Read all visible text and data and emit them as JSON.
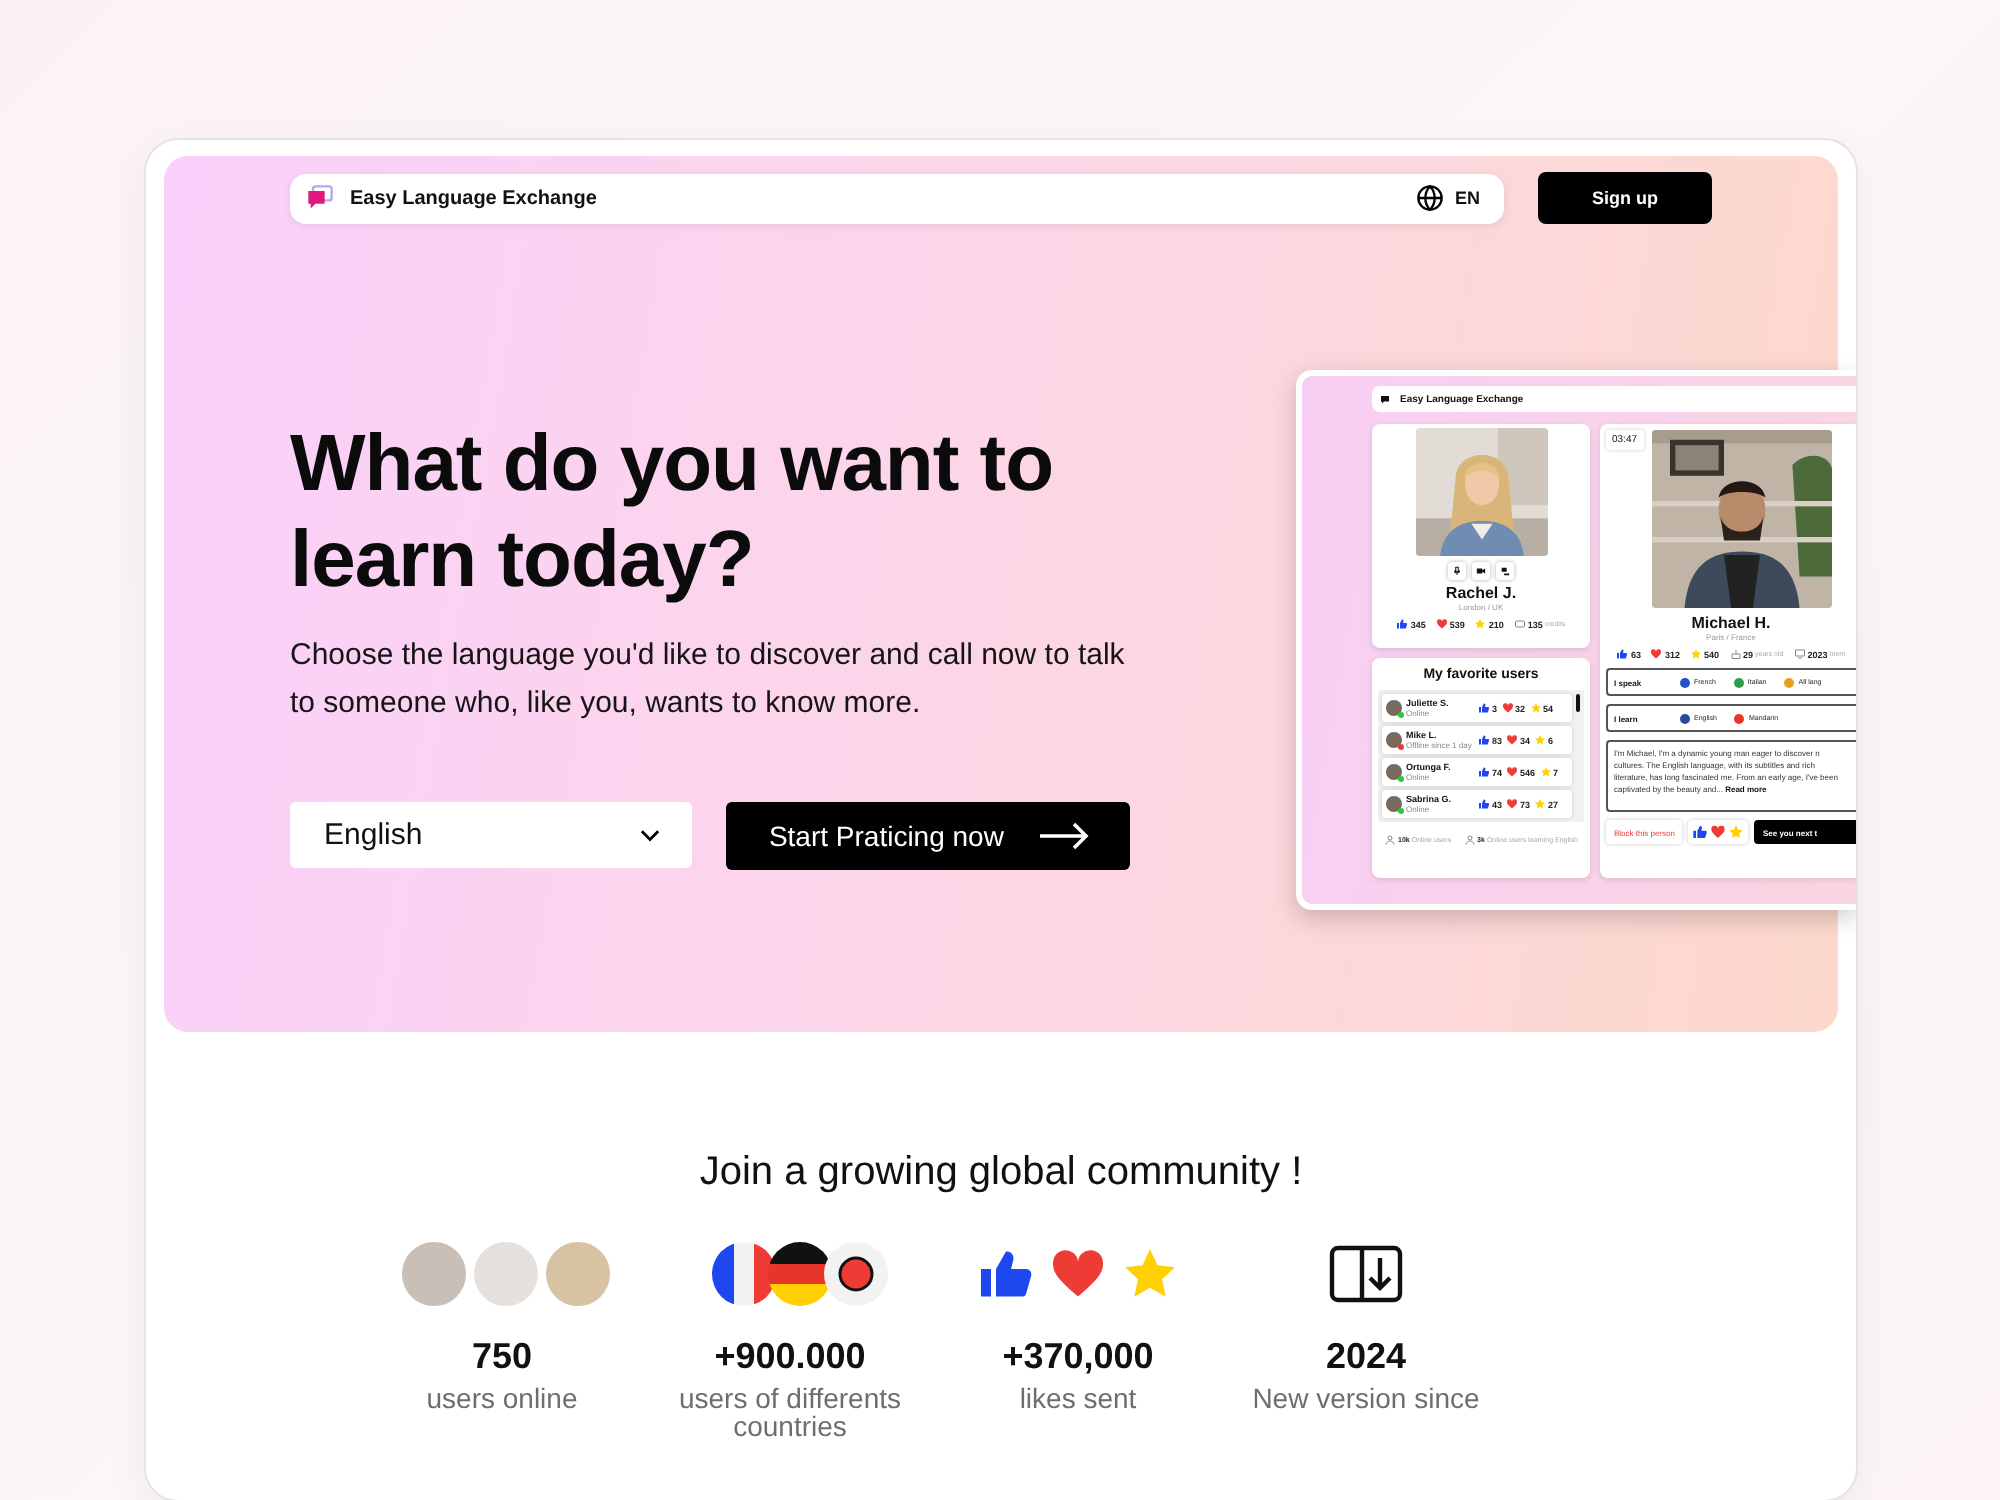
{
  "nav": {
    "logo": "Easy Language Exchange",
    "language": "EN",
    "signup": "Sign up"
  },
  "hero": {
    "title": "What do you want to learn today?",
    "subtitle": "Choose the language you'd like to discover and call now to talk to someone who, like you, wants to know more.",
    "select": "English",
    "cta": "Start Praticing now"
  },
  "preview": {
    "app_title": "Easy Language Exchange",
    "profile": {
      "name": "Rachel J.",
      "location": "London / UK",
      "likes": "345",
      "hearts": "539",
      "stars": "210",
      "credits": "135",
      "credits_label": "credits"
    },
    "favorites": {
      "title": "My favorite users",
      "users": [
        {
          "name": "Juliette S.",
          "status": "Online",
          "online": true,
          "likes": "3",
          "hearts": "32",
          "stars": "54"
        },
        {
          "name": "Mike L.",
          "status": "Offline since 1 day",
          "online": false,
          "likes": "83",
          "hearts": "34",
          "stars": "6"
        },
        {
          "name": "Ortunga F.",
          "status": "Online",
          "online": true,
          "likes": "74",
          "hearts": "546",
          "stars": "7"
        },
        {
          "name": "Sabrina G.",
          "status": "Online",
          "online": true,
          "likes": "43",
          "hearts": "73",
          "stars": "27"
        }
      ],
      "footer": [
        {
          "value": "10k",
          "label": "Online users"
        },
        {
          "value": "3k",
          "label": "Online users learning English"
        }
      ]
    },
    "call": {
      "timer": "03:47",
      "name": "Michael H.",
      "location": "Paris / France",
      "likes": "63",
      "hearts": "312",
      "stars": "540",
      "age": "29",
      "age_label": "years old",
      "member": "2023",
      "member_label": "mem",
      "speaks": {
        "label": "I speak",
        "languages": [
          {
            "name": "French",
            "color": "#2450c8"
          },
          {
            "name": "Italian",
            "color": "#2e9e48"
          },
          {
            "name": "All lang",
            "color": "#e8a020"
          }
        ]
      },
      "learns": {
        "label": "I learn",
        "languages": [
          {
            "name": "English",
            "color": "#2a4a9a"
          },
          {
            "name": "Mandarin",
            "color": "#e8352a"
          }
        ]
      },
      "bio": "I'm Michael, I'm a dynamic young man eager to discover n cultures. The English language, with its subtitles and rich literature, has long fascinated me. From an early age, I've been captivated by the beauty and...",
      "read_more": "Read more",
      "block": "Block this person",
      "next": "See you next t"
    }
  },
  "community": {
    "title": "Join a growing global community !",
    "stats": [
      {
        "kind": "avatars",
        "value": "750",
        "label": "users online"
      },
      {
        "kind": "flags",
        "value": "+900.000",
        "label": "users of differents countries"
      },
      {
        "kind": "reactions",
        "value": "+370,000",
        "label": "likes sent"
      },
      {
        "kind": "version",
        "value": "2024",
        "label": "New version since"
      }
    ]
  }
}
